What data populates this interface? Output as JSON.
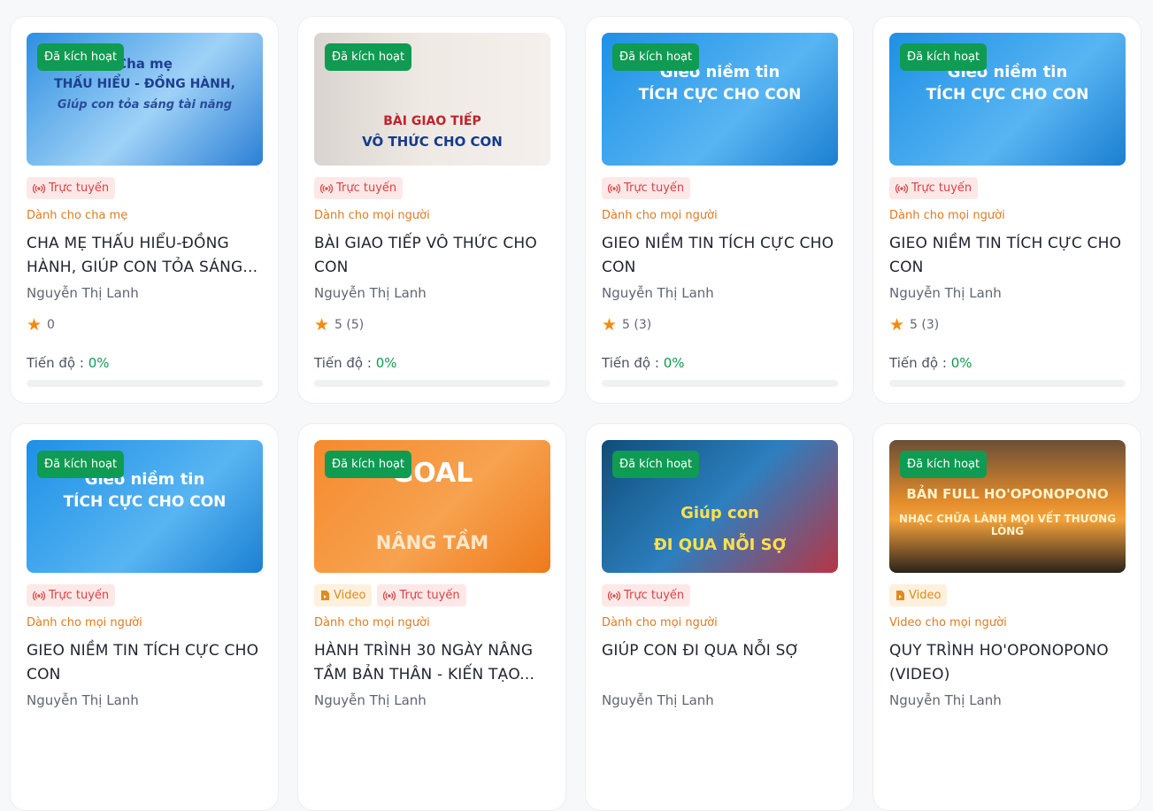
{
  "cards": [
    {
      "badge": "Đã kích hoạt",
      "art": {
        "line1": "Cha mẹ",
        "line2": "THẤU HIỂU - ĐỒNG HÀNH,",
        "line3": "Giúp con tỏa sáng tài năng"
      },
      "tags": [
        {
          "kind": "live",
          "label": "Trực tuyến",
          "icon": "broadcast-icon"
        }
      ],
      "audience": "Dành cho cha mẹ",
      "title": "CHA MẸ THẤU HIỂU-ĐỒNG HÀNH, GIÚP CON TỎA SÁNG...",
      "author": "Nguyễn Thị Lanh",
      "rating": "0",
      "progress_label": "Tiến độ :",
      "progress_value": "0%",
      "progress": 0
    },
    {
      "badge": "Đã kích hoạt",
      "art": {
        "line1": "BÀI GIAO TIẾP",
        "line2": "VÔ THỨC CHO CON",
        "line3": ""
      },
      "tags": [
        {
          "kind": "live",
          "label": "Trực tuyến",
          "icon": "broadcast-icon"
        }
      ],
      "audience": "Dành cho mọi người",
      "title": "BÀI GIAO TIẾP VÔ THỨC CHO CON",
      "author": "Nguyễn Thị Lanh",
      "rating": "5 (5)",
      "progress_label": "Tiến độ :",
      "progress_value": "0%",
      "progress": 0
    },
    {
      "badge": "Đã kích hoạt",
      "art": {
        "line1": "Gieo niềm tin",
        "line2": "TÍCH CỰC CHO CON",
        "line3": ""
      },
      "tags": [
        {
          "kind": "live",
          "label": "Trực tuyến",
          "icon": "broadcast-icon"
        }
      ],
      "audience": "Dành cho mọi người",
      "title": "GIEO NIỀM TIN TÍCH CỰC CHO CON",
      "author": "Nguyễn Thị Lanh",
      "rating": "5 (3)",
      "progress_label": "Tiến độ :",
      "progress_value": "0%",
      "progress": 0
    },
    {
      "badge": "Đã kích hoạt",
      "art": {
        "line1": "Gieo niềm tin",
        "line2": "TÍCH CỰC CHO CON",
        "line3": ""
      },
      "tags": [
        {
          "kind": "live",
          "label": "Trực tuyến",
          "icon": "broadcast-icon"
        }
      ],
      "audience": "Dành cho mọi người",
      "title": "GIEO NIỀM TIN TÍCH CỰC CHO CON",
      "author": "Nguyễn Thị Lanh",
      "rating": "5 (3)",
      "progress_label": "Tiến độ :",
      "progress_value": "0%",
      "progress": 0
    },
    {
      "badge": "Đã kích hoạt",
      "art": {
        "line1": "Gieo niềm tin",
        "line2": "TÍCH CỰC CHO CON",
        "line3": ""
      },
      "tags": [
        {
          "kind": "live",
          "label": "Trực tuyến",
          "icon": "broadcast-icon"
        }
      ],
      "audience": "Dành cho mọi người",
      "title": "GIEO NIỀM TIN TÍCH CỰC CHO CON",
      "author": "Nguyễn Thị Lanh",
      "rating": "",
      "progress_label": "",
      "progress_value": "",
      "progress": 0
    },
    {
      "badge": "Đã kích hoạt",
      "art": {
        "line1": "GOAL",
        "line2": "NÂNG TẦM",
        "line3": ""
      },
      "tags": [
        {
          "kind": "video",
          "label": "Video",
          "icon": "video-file-icon"
        },
        {
          "kind": "live",
          "label": "Trực tuyến",
          "icon": "broadcast-icon"
        }
      ],
      "audience": "Dành cho mọi người",
      "title": "HÀNH TRÌNH 30 NGÀY NÂNG TẦM BẢN THÂN - KIẾN TẠO...",
      "author": "Nguyễn Thị Lanh",
      "rating": "",
      "progress_label": "",
      "progress_value": "",
      "progress": 0
    },
    {
      "badge": "Đã kích hoạt",
      "art": {
        "line1": "Giúp con",
        "line2": "ĐI QUA NỖI SỢ",
        "line3": ""
      },
      "tags": [
        {
          "kind": "live",
          "label": "Trực tuyến",
          "icon": "broadcast-icon"
        }
      ],
      "audience": "Dành cho mọi người",
      "title": "GIÚP CON ĐI QUA NỖI SỢ",
      "author": "Nguyễn Thị Lanh",
      "rating": "",
      "progress_label": "",
      "progress_value": "",
      "progress": 0
    },
    {
      "badge": "Đã kích hoạt",
      "art": {
        "line1": "BẢN FULL HO'OPONOPONO",
        "line2": "NHẠC CHỮA LÀNH MỌI VẾT THƯƠNG LÒNG",
        "line3": ""
      },
      "tags": [
        {
          "kind": "video",
          "label": "Video",
          "icon": "video-file-icon"
        }
      ],
      "audience": "Video cho mọi người",
      "title": "QUY TRÌNH HO'OPONOPONO (VIDEO)",
      "author": "Nguyễn Thị Lanh",
      "rating": "",
      "progress_label": "",
      "progress_value": "",
      "progress": 0
    }
  ],
  "colors": {
    "activated": "#0f9b52",
    "live": "#d84343",
    "video": "#e08a1e",
    "audience": "#e07b21",
    "star": "#f28a10"
  }
}
